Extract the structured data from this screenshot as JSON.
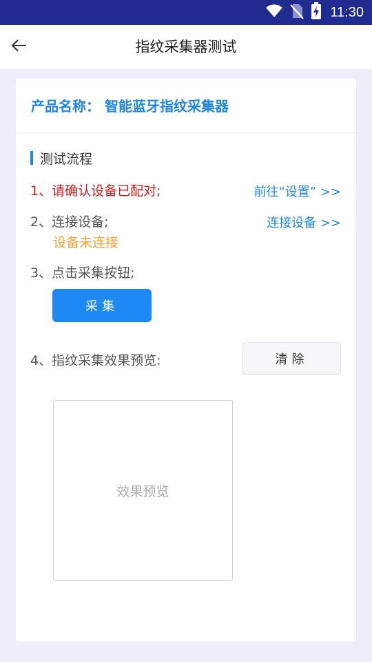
{
  "status_bar": {
    "time": "11:30",
    "icons": [
      "wifi-icon",
      "no-sim-icon",
      "battery-charging-icon"
    ]
  },
  "app_bar": {
    "back_icon": "arrow-left-icon",
    "title": "指纹采集器测试"
  },
  "product": {
    "name_line": "产品名称： 智能蓝牙指纹采集器"
  },
  "section": {
    "title": "测试流程"
  },
  "steps": {
    "step1": {
      "text": "1、请确认设备已配对;",
      "action": "前往“设置” >>"
    },
    "step2": {
      "text": "2、连接设备;",
      "action": "连接设备 >>",
      "status": "设备未连接"
    },
    "step3": {
      "text": "3、点击采集按钮;",
      "button": "采集"
    },
    "step4": {
      "text": "4、指纹采集效果预览:",
      "button": "清除"
    }
  },
  "preview": {
    "placeholder": "效果预览"
  },
  "colors": {
    "status_bar": "#1f2b8f",
    "accent_blue": "#1e88e5",
    "warning_red": "#d81b1b",
    "status_orange": "#f5a032",
    "page_bg": "#eeeef8"
  }
}
